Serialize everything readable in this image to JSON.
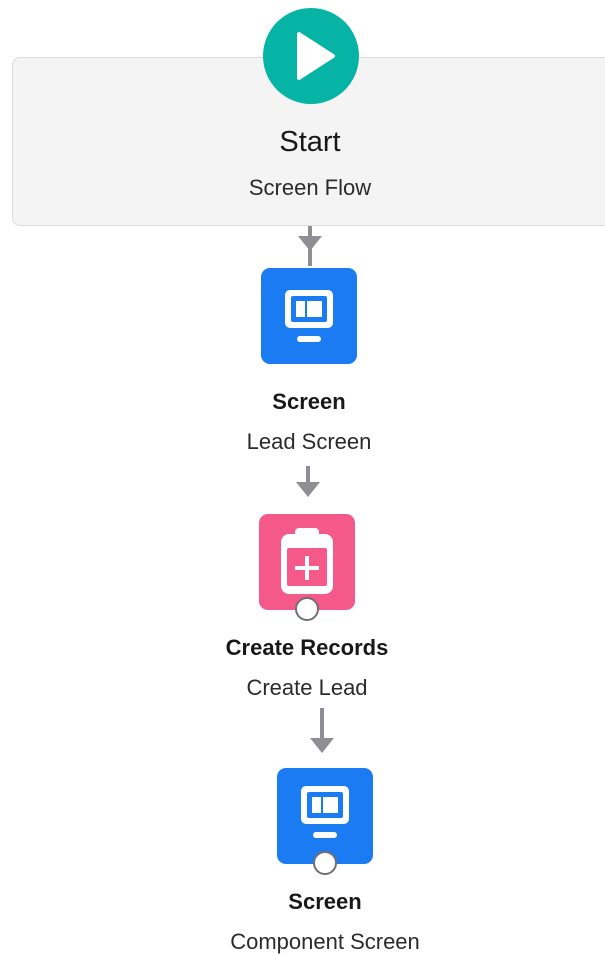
{
  "start": {
    "title": "Start",
    "subtitle": "Screen Flow",
    "icon": "play-icon",
    "color": "#06b4a6"
  },
  "nodes": [
    {
      "type": "Screen",
      "label": "Lead Screen",
      "icon": "screen-icon",
      "color": "#1b7bf2"
    },
    {
      "type": "Create Records",
      "label": "Create Lead",
      "icon": "clipboard-plus-icon",
      "color": "#f5598a"
    },
    {
      "type": "Screen",
      "label": "Component Screen",
      "icon": "screen-icon",
      "color": "#1b7bf2"
    }
  ],
  "connector_color": "#8e8e93"
}
